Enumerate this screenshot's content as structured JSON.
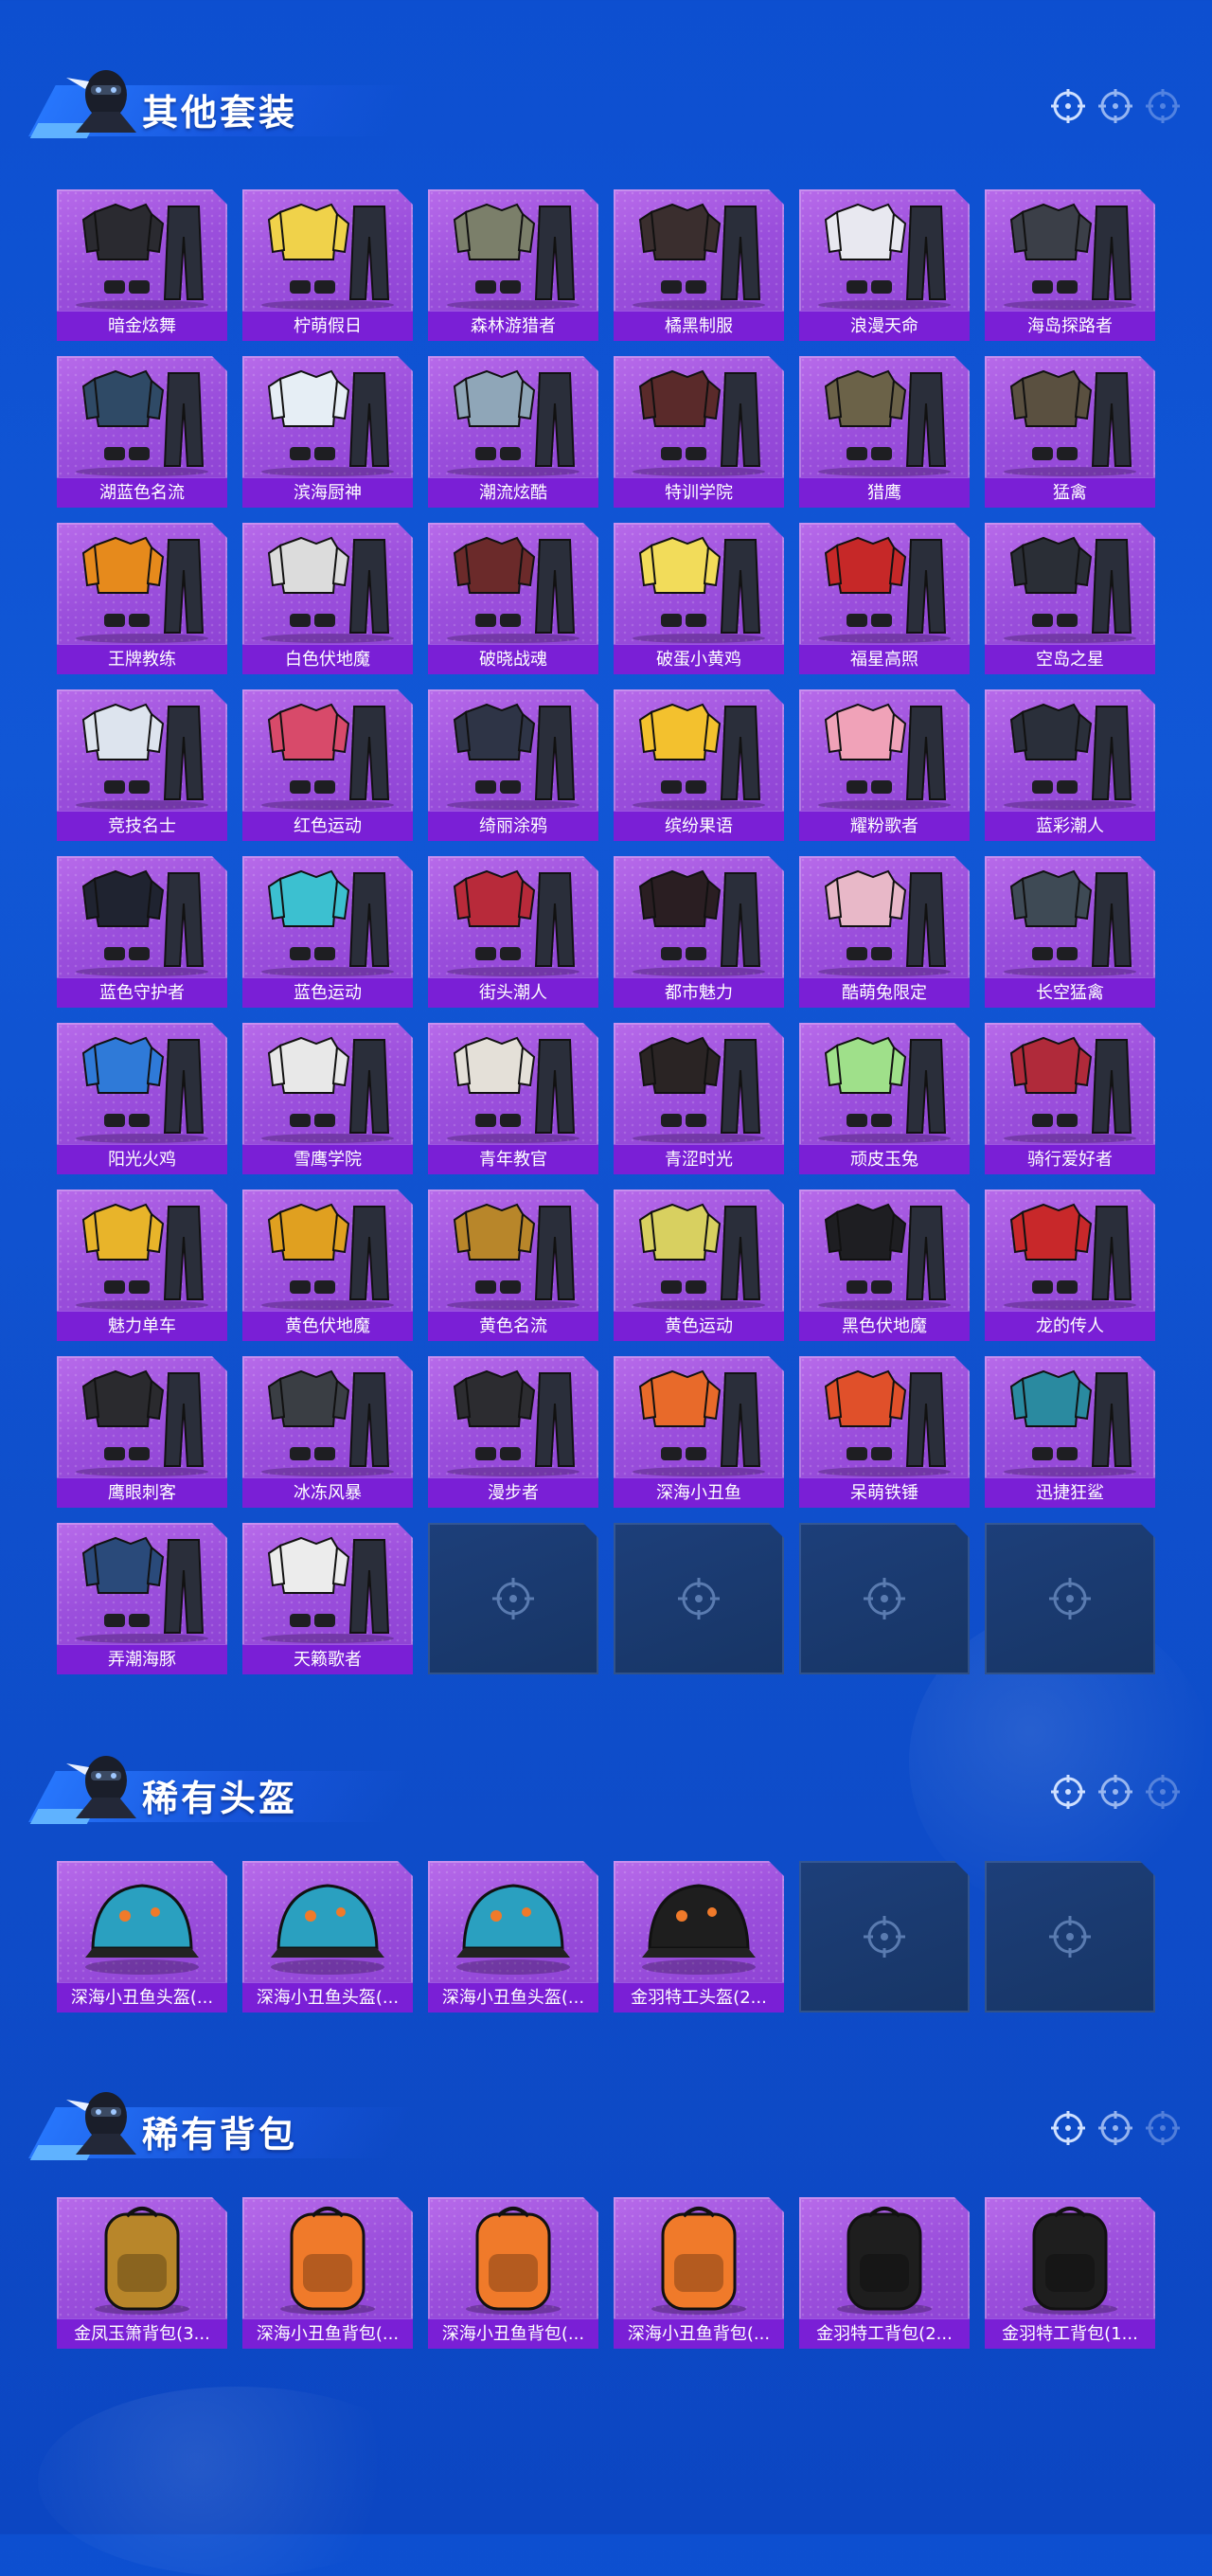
{
  "sections": [
    {
      "title": "其他套装",
      "items": [
        {
          "label": "暗金炫舞",
          "icon": "outfit-icon",
          "tone": "#2a2a30"
        },
        {
          "label": "柠萌假日",
          "icon": "outfit-icon",
          "tone": "#f0d24a"
        },
        {
          "label": "森林游猎者",
          "icon": "outfit-icon",
          "tone": "#7b7f6a"
        },
        {
          "label": "橘黑制服",
          "icon": "outfit-icon",
          "tone": "#3a2e2e"
        },
        {
          "label": "浪漫天命",
          "icon": "outfit-icon",
          "tone": "#e8e8f0"
        },
        {
          "label": "海岛探路者",
          "icon": "outfit-icon",
          "tone": "#3b3f48"
        },
        {
          "label": "湖蓝色名流",
          "icon": "outfit-icon",
          "tone": "#2f4a66"
        },
        {
          "label": "滨海厨神",
          "icon": "outfit-icon",
          "tone": "#e6eef5"
        },
        {
          "label": "潮流炫酷",
          "icon": "outfit-icon",
          "tone": "#8fa6b8"
        },
        {
          "label": "特训学院",
          "icon": "outfit-icon",
          "tone": "#5a2a2a"
        },
        {
          "label": "猎鹰",
          "icon": "outfit-icon",
          "tone": "#6b6248"
        },
        {
          "label": "猛禽",
          "icon": "outfit-icon",
          "tone": "#5a5040"
        },
        {
          "label": "王牌教练",
          "icon": "outfit-icon",
          "tone": "#e68a1c"
        },
        {
          "label": "白色伏地魔",
          "icon": "outfit-icon",
          "tone": "#dcdcdc"
        },
        {
          "label": "破晓战魂",
          "icon": "outfit-icon",
          "tone": "#6b2a2a"
        },
        {
          "label": "破蛋小黄鸡",
          "icon": "outfit-icon",
          "tone": "#f2dc5a"
        },
        {
          "label": "福星高照",
          "icon": "outfit-icon",
          "tone": "#c62828"
        },
        {
          "label": "空岛之星",
          "icon": "outfit-icon",
          "tone": "#2a2e36"
        },
        {
          "label": "竞技名士",
          "icon": "outfit-icon",
          "tone": "#dde4ee"
        },
        {
          "label": "红色运动",
          "icon": "outfit-icon",
          "tone": "#d84a6a"
        },
        {
          "label": "绮丽涂鸦",
          "icon": "outfit-icon",
          "tone": "#2e3446"
        },
        {
          "label": "缤纷果语",
          "icon": "outfit-icon",
          "tone": "#f3c12e"
        },
        {
          "label": "耀粉歌者",
          "icon": "outfit-icon",
          "tone": "#f0a2b8"
        },
        {
          "label": "蓝彩潮人",
          "icon": "outfit-icon",
          "tone": "#2a2f3a"
        },
        {
          "label": "蓝色守护者",
          "icon": "outfit-icon",
          "tone": "#1f2330"
        },
        {
          "label": "蓝色运动",
          "icon": "outfit-icon",
          "tone": "#3cc0d0"
        },
        {
          "label": "街头潮人",
          "icon": "outfit-icon",
          "tone": "#b82a3a"
        },
        {
          "label": "都市魅力",
          "icon": "outfit-icon",
          "tone": "#2a1e22"
        },
        {
          "label": "酷萌兔限定",
          "icon": "outfit-icon",
          "tone": "#e8b8c8"
        },
        {
          "label": "长空猛禽",
          "icon": "outfit-icon",
          "tone": "#3e4a55"
        },
        {
          "label": "阳光火鸡",
          "icon": "outfit-icon",
          "tone": "#2f7ad8"
        },
        {
          "label": "雪鹰学院",
          "icon": "outfit-icon",
          "tone": "#e8e8e8"
        },
        {
          "label": "青年教官",
          "icon": "outfit-icon",
          "tone": "#e4e0d8"
        },
        {
          "label": "青涩时光",
          "icon": "outfit-icon",
          "tone": "#2a2424"
        },
        {
          "label": "顽皮玉兔",
          "icon": "outfit-icon",
          "tone": "#9fe08a"
        },
        {
          "label": "骑行爱好者",
          "icon": "outfit-icon",
          "tone": "#b02a3a"
        },
        {
          "label": "魅力单车",
          "icon": "outfit-icon",
          "tone": "#e8b42a"
        },
        {
          "label": "黄色伏地魔",
          "icon": "outfit-icon",
          "tone": "#e0a020"
        },
        {
          "label": "黄色名流",
          "icon": "outfit-icon",
          "tone": "#b8862a"
        },
        {
          "label": "黄色运动",
          "icon": "outfit-icon",
          "tone": "#d8d060"
        },
        {
          "label": "黑色伏地魔",
          "icon": "outfit-icon",
          "tone": "#1e1e22"
        },
        {
          "label": "龙的传人",
          "icon": "outfit-icon",
          "tone": "#c8282a"
        },
        {
          "label": "鹰眼刺客",
          "icon": "outfit-icon",
          "tone": "#2a2a2e"
        },
        {
          "label": "冰冻风暴",
          "icon": "outfit-icon",
          "tone": "#3a3e44"
        },
        {
          "label": "漫步者",
          "icon": "outfit-icon",
          "tone": "#2c2c30"
        },
        {
          "label": "深海小丑鱼",
          "icon": "outfit-icon",
          "tone": "#e86a2a"
        },
        {
          "label": "呆萌铁锤",
          "icon": "outfit-icon",
          "tone": "#e0502a"
        },
        {
          "label": "迅捷狂鲨",
          "icon": "outfit-icon",
          "tone": "#2a8aa0"
        },
        {
          "label": "弄潮海豚",
          "icon": "outfit-icon",
          "tone": "#2a4a7a"
        },
        {
          "label": "天籁歌者",
          "icon": "outfit-icon",
          "tone": "#ececec"
        },
        {
          "label": "",
          "icon": "empty-slot-icon",
          "empty": true
        },
        {
          "label": "",
          "icon": "empty-slot-icon",
          "empty": true
        },
        {
          "label": "",
          "icon": "empty-slot-icon",
          "empty": true
        },
        {
          "label": "",
          "icon": "empty-slot-icon",
          "empty": true
        }
      ]
    },
    {
      "title": "稀有头盔",
      "items": [
        {
          "label": "深海小丑鱼头盔(...",
          "icon": "helmet-icon",
          "tone": "#2aa0c0"
        },
        {
          "label": "深海小丑鱼头盔(...",
          "icon": "helmet-icon",
          "tone": "#2aa0c0"
        },
        {
          "label": "深海小丑鱼头盔(...",
          "icon": "helmet-icon",
          "tone": "#2aa0c0"
        },
        {
          "label": "金羽特工头盔(2...",
          "icon": "helmet-icon",
          "tone": "#1e1e1e"
        },
        {
          "label": "",
          "icon": "empty-slot-icon",
          "empty": true
        },
        {
          "label": "",
          "icon": "empty-slot-icon",
          "empty": true
        }
      ]
    },
    {
      "title": "稀有背包",
      "items": [
        {
          "label": "金凤玉箫背包(3...",
          "icon": "backpack-icon",
          "tone": "#b8862a"
        },
        {
          "label": "深海小丑鱼背包(...",
          "icon": "backpack-icon",
          "tone": "#f07a2a"
        },
        {
          "label": "深海小丑鱼背包(...",
          "icon": "backpack-icon",
          "tone": "#f07a2a"
        },
        {
          "label": "深海小丑鱼背包(...",
          "icon": "backpack-icon",
          "tone": "#f07a2a"
        },
        {
          "label": "金羽特工背包(2...",
          "icon": "backpack-icon",
          "tone": "#1e1e1e"
        },
        {
          "label": "金羽特工背包(1...",
          "icon": "backpack-icon",
          "tone": "#1e1e1e"
        }
      ]
    }
  ]
}
